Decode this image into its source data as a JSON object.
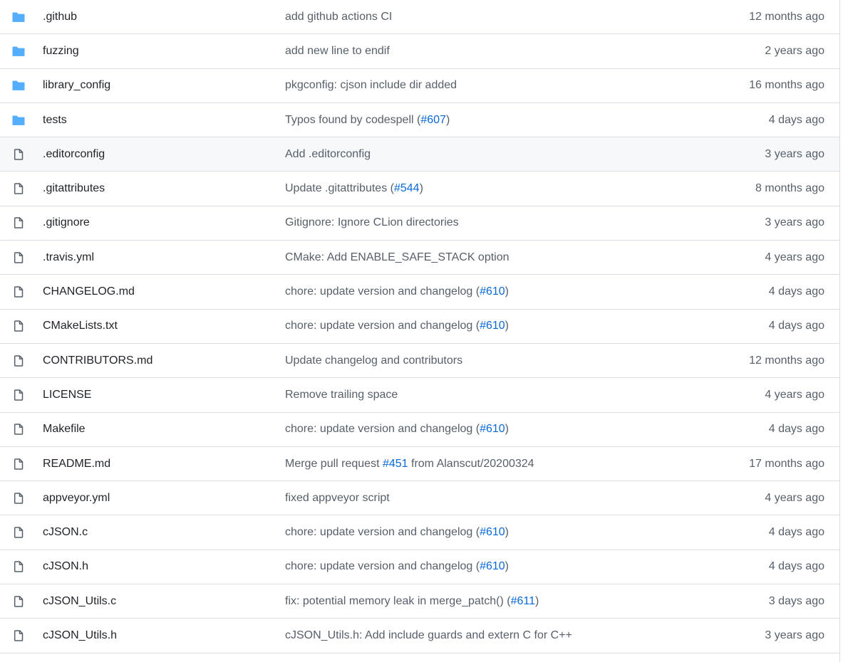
{
  "colors": {
    "folder": "#54aeff",
    "file": "#57606a",
    "link": "#0969da",
    "muted_text": "#57606a",
    "border": "#d8dee4",
    "row_highlight": "#f6f8fa"
  },
  "files": [
    {
      "type": "dir",
      "icon": "folder-icon",
      "name": ".github",
      "message": [
        {
          "text": "add github actions CI"
        }
      ],
      "age": "12 months ago"
    },
    {
      "type": "dir",
      "icon": "folder-icon",
      "name": "fuzzing",
      "message": [
        {
          "text": "add new line to endif"
        }
      ],
      "age": "2 years ago"
    },
    {
      "type": "dir",
      "icon": "folder-icon",
      "name": "library_config",
      "message": [
        {
          "text": "pkgconfig: cjson include dir added"
        }
      ],
      "age": "16 months ago"
    },
    {
      "type": "dir",
      "icon": "folder-icon",
      "name": "tests",
      "message": [
        {
          "text": "Typos found by codespell ("
        },
        {
          "text": "#607",
          "link": true
        },
        {
          "text": ")"
        }
      ],
      "age": "4 days ago"
    },
    {
      "type": "file",
      "icon": "file-icon",
      "name": ".editorconfig",
      "message": [
        {
          "text": "Add .editorconfig"
        }
      ],
      "age": "3 years ago",
      "highlight": true
    },
    {
      "type": "file",
      "icon": "file-icon",
      "name": ".gitattributes",
      "message": [
        {
          "text": "Update .gitattributes ("
        },
        {
          "text": "#544",
          "link": true
        },
        {
          "text": ")"
        }
      ],
      "age": "8 months ago"
    },
    {
      "type": "file",
      "icon": "file-icon",
      "name": ".gitignore",
      "message": [
        {
          "text": "Gitignore: Ignore CLion directories"
        }
      ],
      "age": "3 years ago"
    },
    {
      "type": "file",
      "icon": "file-icon",
      "name": ".travis.yml",
      "message": [
        {
          "text": "CMake: Add ENABLE_SAFE_STACK option"
        }
      ],
      "age": "4 years ago"
    },
    {
      "type": "file",
      "icon": "file-icon",
      "name": "CHANGELOG.md",
      "message": [
        {
          "text": "chore: update version and changelog ("
        },
        {
          "text": "#610",
          "link": true
        },
        {
          "text": ")"
        }
      ],
      "age": "4 days ago"
    },
    {
      "type": "file",
      "icon": "file-icon",
      "name": "CMakeLists.txt",
      "message": [
        {
          "text": "chore: update version and changelog ("
        },
        {
          "text": "#610",
          "link": true
        },
        {
          "text": ")"
        }
      ],
      "age": "4 days ago"
    },
    {
      "type": "file",
      "icon": "file-icon",
      "name": "CONTRIBUTORS.md",
      "message": [
        {
          "text": "Update changelog and contributors"
        }
      ],
      "age": "12 months ago"
    },
    {
      "type": "file",
      "icon": "file-icon",
      "name": "LICENSE",
      "message": [
        {
          "text": "Remove trailing space"
        }
      ],
      "age": "4 years ago"
    },
    {
      "type": "file",
      "icon": "file-icon",
      "name": "Makefile",
      "message": [
        {
          "text": "chore: update version and changelog ("
        },
        {
          "text": "#610",
          "link": true
        },
        {
          "text": ")"
        }
      ],
      "age": "4 days ago"
    },
    {
      "type": "file",
      "icon": "file-icon",
      "name": "README.md",
      "message": [
        {
          "text": "Merge pull request "
        },
        {
          "text": "#451",
          "link": true
        },
        {
          "text": " from Alanscut/20200324"
        }
      ],
      "age": "17 months ago"
    },
    {
      "type": "file",
      "icon": "file-icon",
      "name": "appveyor.yml",
      "message": [
        {
          "text": "fixed appveyor script"
        }
      ],
      "age": "4 years ago"
    },
    {
      "type": "file",
      "icon": "file-icon",
      "name": "cJSON.c",
      "message": [
        {
          "text": "chore: update version and changelog ("
        },
        {
          "text": "#610",
          "link": true
        },
        {
          "text": ")"
        }
      ],
      "age": "4 days ago"
    },
    {
      "type": "file",
      "icon": "file-icon",
      "name": "cJSON.h",
      "message": [
        {
          "text": "chore: update version and changelog ("
        },
        {
          "text": "#610",
          "link": true
        },
        {
          "text": ")"
        }
      ],
      "age": "4 days ago"
    },
    {
      "type": "file",
      "icon": "file-icon",
      "name": "cJSON_Utils.c",
      "message": [
        {
          "text": "fix: potential memory leak in merge_patch() ("
        },
        {
          "text": "#611",
          "link": true
        },
        {
          "text": ")"
        }
      ],
      "age": "3 days ago"
    },
    {
      "type": "file",
      "icon": "file-icon",
      "name": "cJSON_Utils.h",
      "message": [
        {
          "text": "cJSON_Utils.h: Add include guards and extern C for C++"
        }
      ],
      "age": "3 years ago"
    }
  ]
}
